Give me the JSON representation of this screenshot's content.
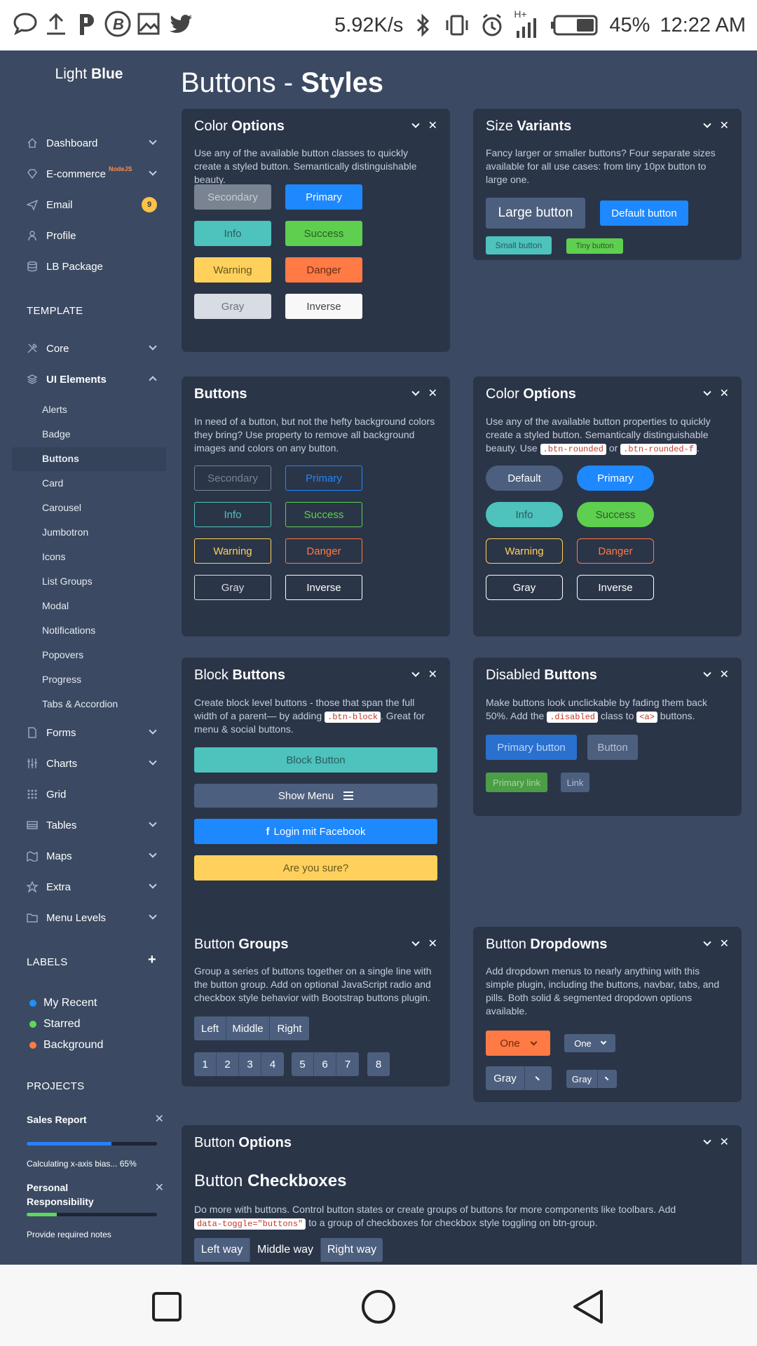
{
  "status_bar": {
    "speed": "5.92K/s",
    "network": "H+",
    "battery": "45%",
    "time": "12:22 AM"
  },
  "sidebar": {
    "logo_light": "Light",
    "logo_bold": "Blue",
    "main_items": [
      {
        "label": "Dashboard",
        "icon": "home-icon"
      },
      {
        "label": "E-commerce",
        "icon": "diamond-icon",
        "badge": "NodeJS"
      },
      {
        "label": "Email",
        "icon": "paper-plane-icon",
        "count": "9"
      },
      {
        "label": "Profile",
        "icon": "user-icon"
      },
      {
        "label": "LB Package",
        "icon": "database-icon"
      }
    ],
    "template_heading": "TEMPLATE",
    "core_label": "Core",
    "ui_elements_label": "UI Elements",
    "ui_sub_items": [
      "Alerts",
      "Badge",
      "Buttons",
      "Card",
      "Carousel",
      "Jumbotron",
      "Icons",
      "List Groups",
      "Modal",
      "Notifications",
      "Popovers",
      "Progress",
      "Tabs & Accordion"
    ],
    "active_sub_item": "Buttons",
    "more_items": [
      {
        "label": "Forms",
        "icon": "document-icon"
      },
      {
        "label": "Charts",
        "icon": "sliders-icon"
      },
      {
        "label": "Grid",
        "icon": "grid-icon"
      },
      {
        "label": "Tables",
        "icon": "table-icon"
      },
      {
        "label": "Maps",
        "icon": "map-icon"
      },
      {
        "label": "Extra",
        "icon": "star-icon"
      },
      {
        "label": "Menu Levels",
        "icon": "folder-icon"
      }
    ],
    "labels_heading": "LABELS",
    "labels": [
      {
        "label": "My Recent",
        "color": "#1e90ff"
      },
      {
        "label": "Starred",
        "color": "#5dd85d"
      },
      {
        "label": "Background",
        "color": "#ff7a45"
      }
    ],
    "projects_heading": "PROJECTS",
    "projects": [
      {
        "title": "Sales Report",
        "note": "Calculating x-axis bias... 65%",
        "progress": 0.65,
        "color": "#2a7fff"
      },
      {
        "title": "Personal Responsibility",
        "note": "Provide required notes",
        "progress": 0.23,
        "color": "#5dd85d"
      }
    ]
  },
  "page": {
    "title_light": "Buttons - ",
    "title_bold": "Styles"
  },
  "cards": {
    "color_options": {
      "title_light": "Color ",
      "title_bold": "Options",
      "desc": "Use any of the available button classes to quickly create a styled button. Semantically distinguishable beauty.",
      "buttons": [
        "Secondary",
        "Primary",
        "Info",
        "Success",
        "Warning",
        "Danger",
        "Gray",
        "Inverse"
      ]
    },
    "size_variants": {
      "title_light": "Size ",
      "title_bold": "Variants",
      "desc": "Fancy larger or smaller buttons? Four separate sizes available for all use cases: from tiny 10px button to large one.",
      "large": "Large button",
      "default": "Default button",
      "small": "Small button",
      "tiny": "Tiny button"
    },
    "outline_buttons": {
      "title_bold": "Buttons",
      "desc": "In need of a button, but not the hefty background colors they bring? Use property to remove all background images and colors on any button.",
      "buttons": [
        "Secondary",
        "Primary",
        "Info",
        "Success",
        "Warning",
        "Danger",
        "Gray",
        "Inverse"
      ]
    },
    "rounded_options": {
      "title_light": "Color ",
      "title_bold": "Options",
      "desc_a": "Use any of the available button properties to quickly create a styled button. Semantically distinguishable beauty. Use ",
      "code_a": ".btn-rounded",
      "desc_b": " or ",
      "code_b": ".btn-rounded-f",
      "desc_c": ".",
      "buttons": [
        "Default",
        "Primary",
        "Info",
        "Success",
        "Warning",
        "Danger",
        "Gray",
        "Inverse"
      ]
    },
    "block_buttons": {
      "title_light": "Block ",
      "title_bold": "Buttons",
      "desc_a": "Create block level buttons - those that span the full width of a parent— by adding ",
      "code": ".btn-block",
      "desc_b": ". Great for menu & social buttons.",
      "block": "Block Button",
      "menu": "Show Menu",
      "facebook": "Login mit Facebook",
      "sure": "Are you sure?"
    },
    "disabled_buttons": {
      "title_light": "Disabled ",
      "title_bold": "Buttons",
      "desc_a": "Make buttons look unclickable by fading them back 50%. Add the ",
      "code_a": ".disabled",
      "desc_b": " class to ",
      "code_b": "<a>",
      "desc_c": " buttons.",
      "primary_button": "Primary button",
      "button": "Button",
      "primary_link": "Primary link",
      "link": "Link"
    },
    "button_groups": {
      "title_light": "Button ",
      "title_bold": "Groups",
      "desc": "Group a series of buttons together on a single line with the button group. Add on optional JavaScript radio and checkbox style behavior with Bootstrap buttons plugin.",
      "group1": [
        "Left",
        "Middle",
        "Right"
      ],
      "group2": [
        "1",
        "2",
        "3",
        "4"
      ],
      "group3": [
        "5",
        "6",
        "7"
      ],
      "group4": [
        "8"
      ]
    },
    "button_dropdowns": {
      "title_light": "Button ",
      "title_bold": "Dropdowns",
      "desc": "Add dropdown menus to nearly anything with this simple plugin, including the buttons, navbar, tabs, and pills. Both solid & segmented dropdown options available.",
      "one_large": "One",
      "one_small": "One",
      "gray_large": "Gray",
      "gray_small": "Gray"
    },
    "button_options": {
      "title_light": "Button ",
      "title_bold": "Options",
      "sub_light": "Button ",
      "sub_bold": "Checkboxes",
      "desc_a": "Do more with buttons. Control button states or create groups of buttons for more components like toolbars. Add ",
      "code": "data-toggle=\"buttons\"",
      "desc_b": " to a group of checkboxes for checkbox style toggling on btn-group.",
      "group": [
        "Left way",
        "Middle way",
        "Right way"
      ]
    }
  },
  "colors": {
    "primary": "#1e88ff",
    "info": "#4ec2bd",
    "success": "#5ecf4f",
    "warning": "#ffd15c",
    "danger": "#ff7a45",
    "secondary": "#7a8391",
    "gray": "#d8dce3",
    "inverse": "#f8f8f8",
    "card_bg": "#2b3548",
    "page_bg": "#3b4a62"
  }
}
